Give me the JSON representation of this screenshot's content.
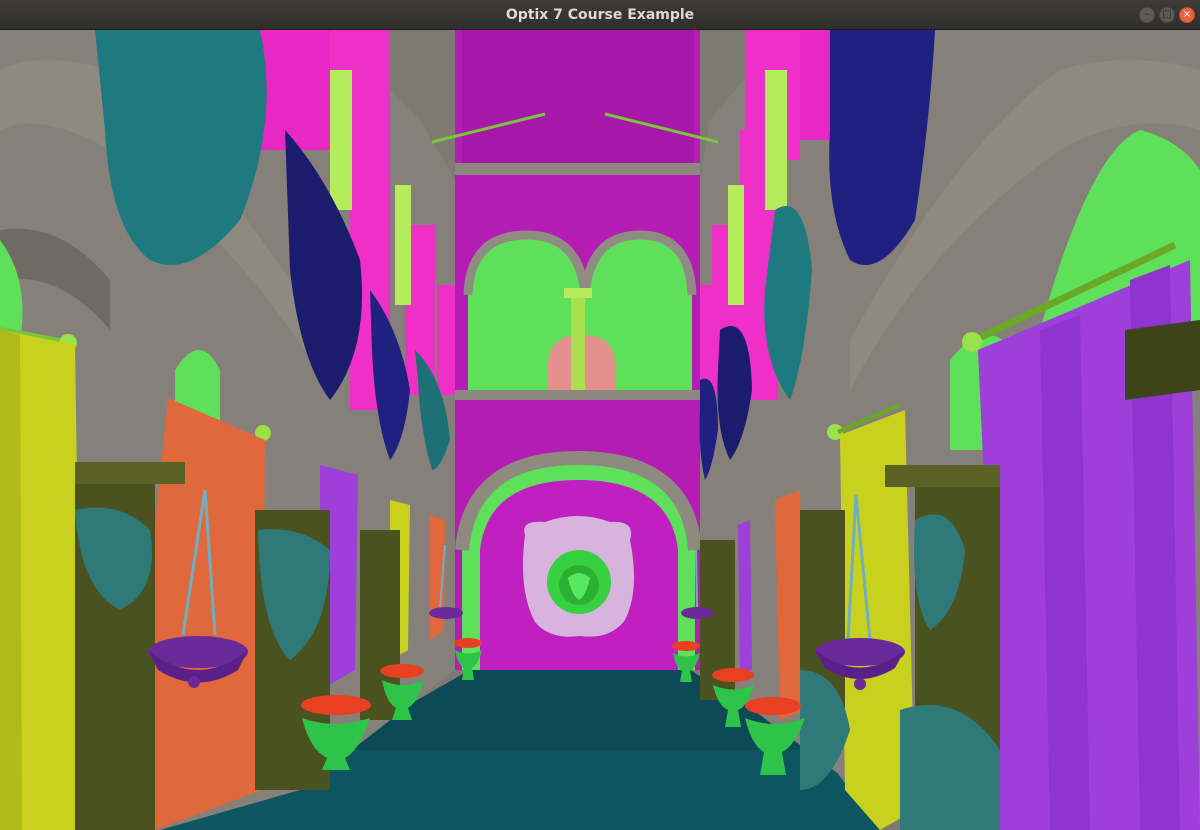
{
  "window": {
    "title": "Optix 7 Course Example",
    "buttons": [
      {
        "name": "minimize",
        "glyph": "–"
      },
      {
        "name": "maximize",
        "glyph": "□"
      },
      {
        "name": "close",
        "glyph": "×"
      }
    ]
  },
  "scene": {
    "description_colors": {
      "back_wall": "#b41cb4",
      "floor": "#0e5562",
      "stone": "#8e8a80",
      "bright_green": "#5ee05a",
      "pink": "#ee2fc8",
      "teal_drape": "#1f7a80",
      "navy_drape": "#1c1c6e",
      "yellow_curtain": "#c8d21e",
      "orange_curtain": "#e0683c",
      "purple_curtain": "#9d3fd8"
    }
  }
}
